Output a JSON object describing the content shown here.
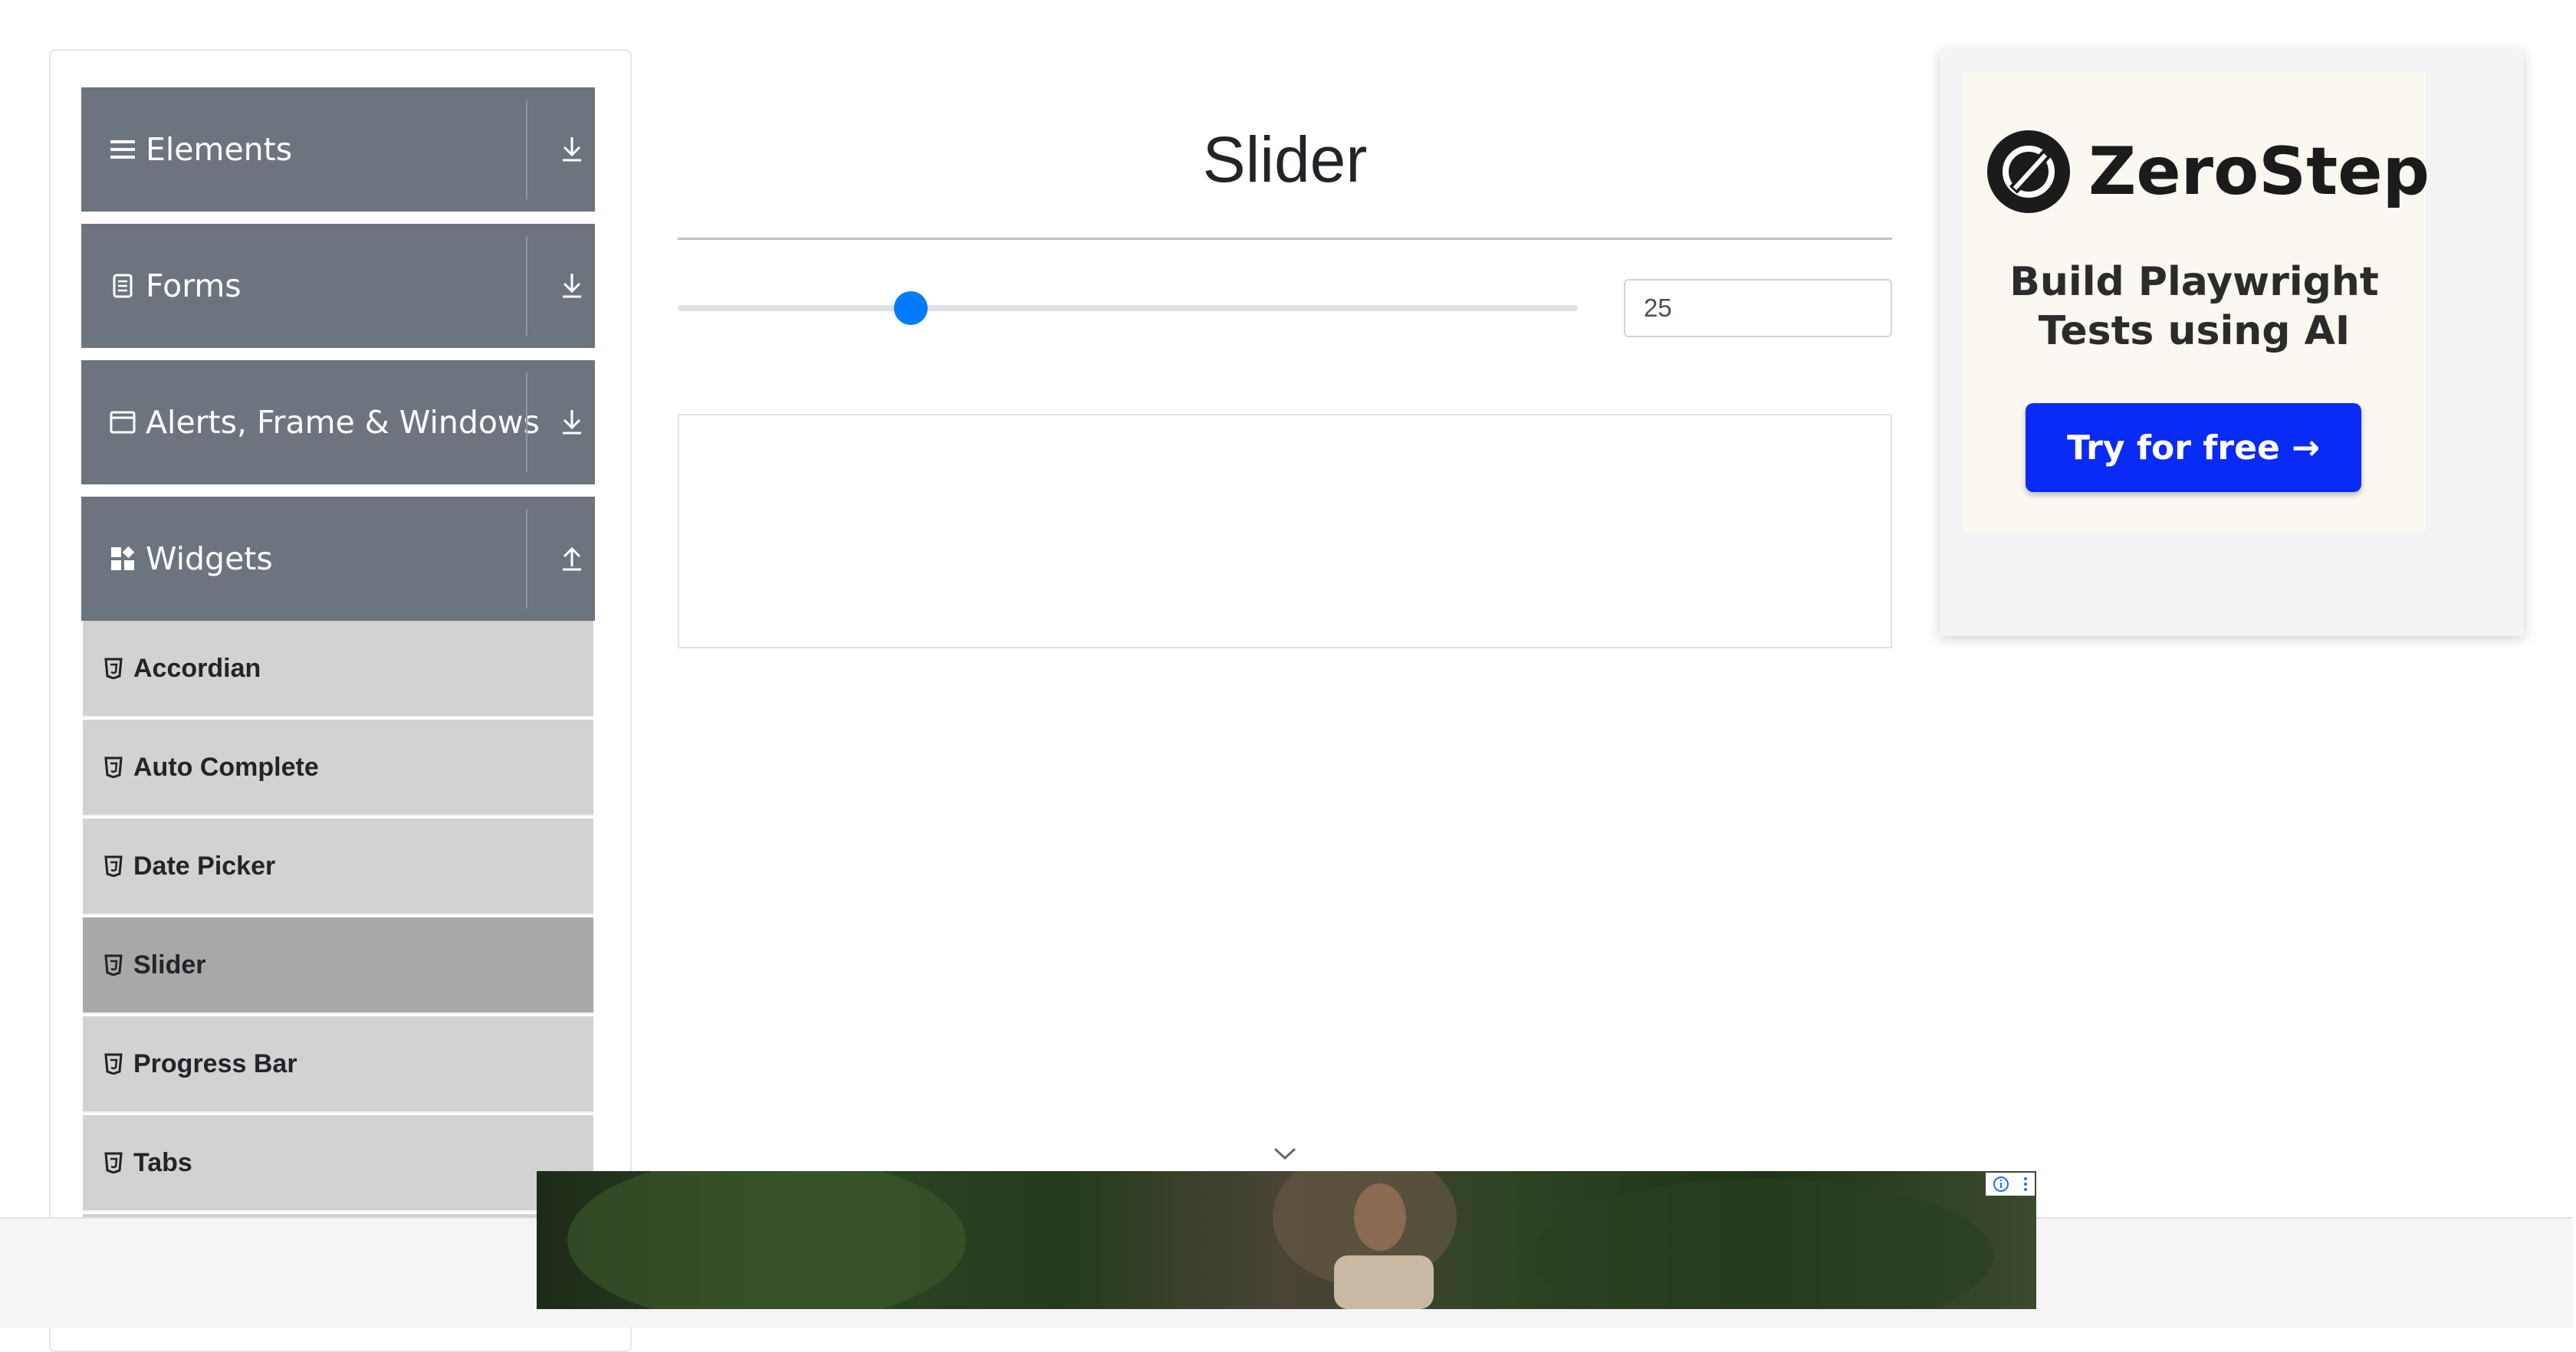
{
  "sidebar": {
    "groups": [
      {
        "label": "Elements",
        "icon": "hamburger-icon",
        "state": "collapsed"
      },
      {
        "label": "Forms",
        "icon": "document-icon",
        "state": "collapsed"
      },
      {
        "label": "Alerts, Frame & Windows",
        "icon": "window-icon",
        "state": "collapsed"
      },
      {
        "label": "Widgets",
        "icon": "widgets-icon",
        "state": "expanded"
      }
    ],
    "widget_items": [
      {
        "label": "Accordian"
      },
      {
        "label": "Auto Complete"
      },
      {
        "label": "Date Picker"
      },
      {
        "label": "Slider",
        "active": true
      },
      {
        "label": "Progress Bar"
      },
      {
        "label": "Tabs"
      }
    ]
  },
  "main": {
    "title": "Slider",
    "slider": {
      "value": "25",
      "min": 0,
      "max": 100,
      "accent": "#007bff"
    }
  },
  "ad": {
    "brand": "ZeroStep",
    "tagline_line1": "Build Playwright",
    "tagline_line2": "Tests using AI",
    "cta": "Try for free →",
    "cta_color": "#0a2bf5"
  },
  "colors": {
    "sidebar_group_bg": "#6c757d",
    "menu_item_bg": "#d2d2d2",
    "menu_item_active_bg": "#a8a8a8"
  }
}
